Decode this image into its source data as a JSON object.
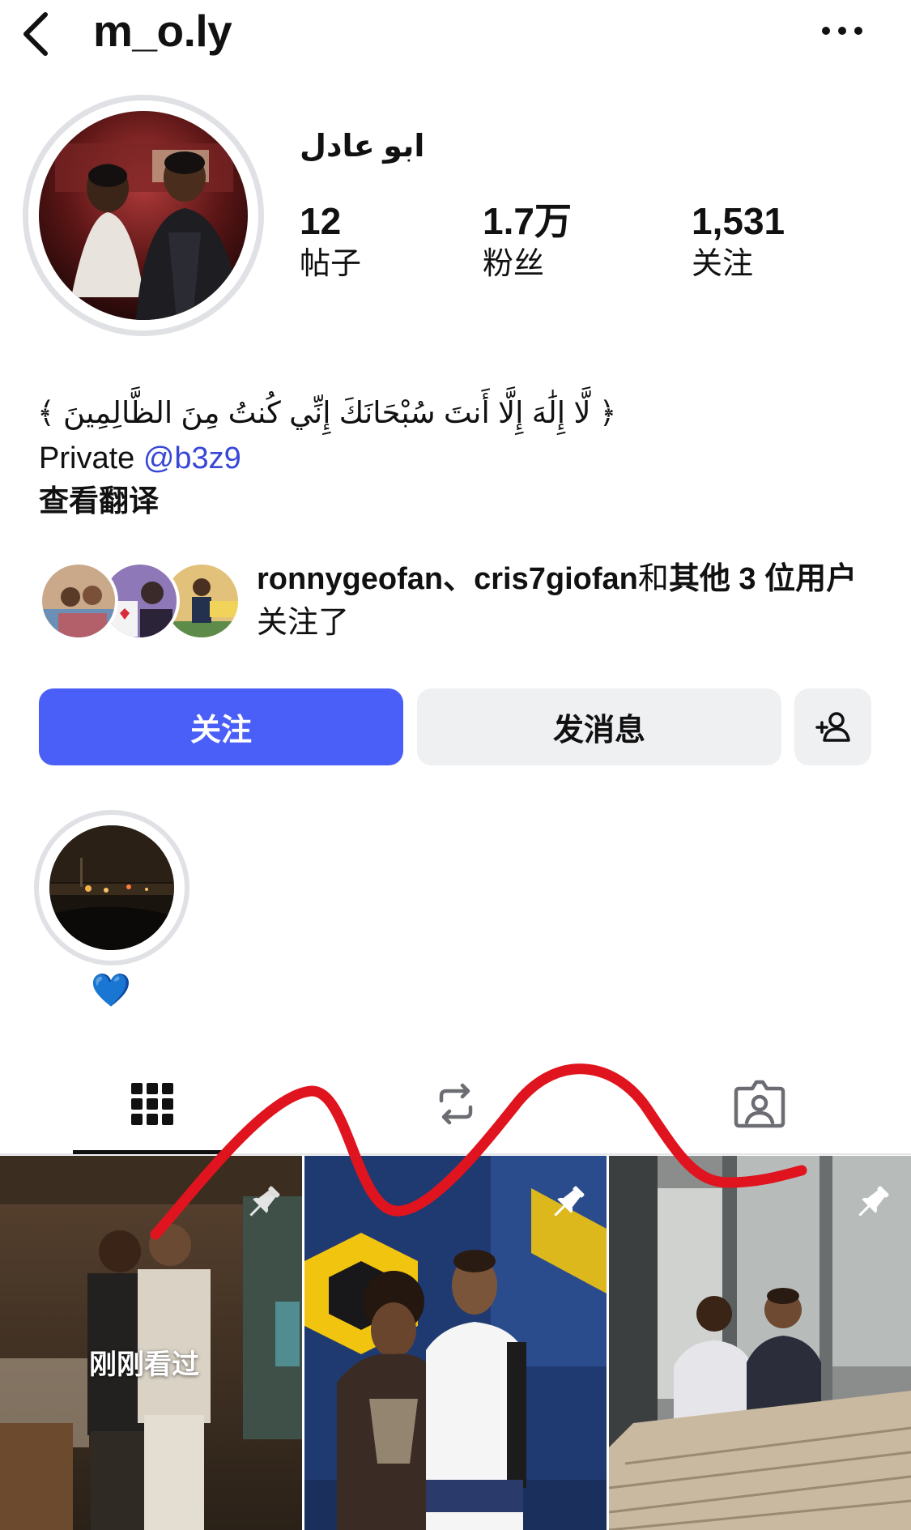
{
  "header": {
    "username": "m_o.ly",
    "back_icon": "chevron-left-icon",
    "more_icon": "more-horizontal-icon"
  },
  "profile": {
    "display_name": "ابو عادل",
    "stats": {
      "posts": {
        "value": "12",
        "label": "帖子"
      },
      "followers": {
        "value": "1.7万",
        "label": "粉丝"
      },
      "following": {
        "value": "1,531",
        "label": "关注"
      }
    },
    "bio": {
      "arabic_line": "﴿ لَّا إِلَٰهَ إِلَّا أَنتَ سُبْحَانَكَ إِنِّي كُنتُ مِنَ الظَّالِمِينَ ﴾",
      "private_label": "Private",
      "handle": "@b3z9",
      "translate_label": "查看翻译"
    }
  },
  "mutuals": {
    "bold_names": "ronnygeofan、cris7giofan",
    "connector": "和",
    "others": "其他 3 位用户",
    "suffix": "关注了"
  },
  "actions": {
    "follow_label": "关注",
    "message_label": "发消息",
    "suggest_icon": "add-person-icon"
  },
  "highlights": [
    {
      "label": "💙"
    }
  ],
  "tabs": [
    {
      "name": "posts",
      "icon": "grid-icon",
      "active": true
    },
    {
      "name": "reposts",
      "icon": "repost-icon",
      "active": false
    },
    {
      "name": "tagged",
      "icon": "tagged-person-icon",
      "active": false
    }
  ],
  "grid": {
    "posts": [
      {
        "pinned": true,
        "overlay": "刚刚看过"
      },
      {
        "pinned": true
      },
      {
        "pinned": true
      }
    ]
  },
  "colors": {
    "accent": "#4a5ff7",
    "link": "#3847d6",
    "button_gray": "#eff0f2",
    "scribble": "#e0141e"
  }
}
